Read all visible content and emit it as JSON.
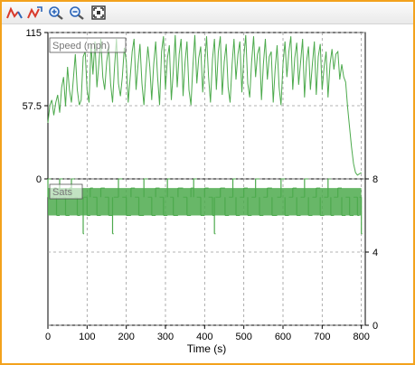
{
  "toolbar": {
    "buttons": [
      {
        "name": "autoscale-y-icon",
        "color": "#d93a2b"
      },
      {
        "name": "autoscale-x-icon",
        "color": "#d93a2b"
      },
      {
        "name": "zoom-in-icon",
        "color": "#2a64b8"
      },
      {
        "name": "zoom-out-icon",
        "color": "#2a64b8"
      },
      {
        "name": "fit-all-icon",
        "color": "#333333"
      }
    ]
  },
  "colors": {
    "frame": "#f3a21d",
    "series": "#4daa4d",
    "grid": "#9a9a9a",
    "axis": "#000000"
  },
  "chart_data": [
    {
      "type": "line",
      "series": [
        {
          "name": "Speed (mph)"
        }
      ],
      "xlabel": "Time (s)",
      "x_ticks": [
        0,
        100,
        200,
        300,
        400,
        500,
        600,
        700,
        800
      ],
      "xlim": [
        0,
        810
      ],
      "y_ticks": [
        "0",
        "57.5",
        "115"
      ],
      "ylim": [
        0,
        115
      ],
      "grid": true,
      "legend": "top-left",
      "points": [
        [
          0,
          44
        ],
        [
          5,
          58
        ],
        [
          10,
          62
        ],
        [
          15,
          50
        ],
        [
          20,
          60
        ],
        [
          25,
          66
        ],
        [
          30,
          52
        ],
        [
          35,
          72
        ],
        [
          40,
          80
        ],
        [
          45,
          57
        ],
        [
          50,
          88
        ],
        [
          55,
          70
        ],
        [
          60,
          60
        ],
        [
          65,
          79
        ],
        [
          70,
          98
        ],
        [
          75,
          70
        ],
        [
          80,
          58
        ],
        [
          85,
          62
        ],
        [
          90,
          96
        ],
        [
          95,
          100
        ],
        [
          100,
          70
        ],
        [
          105,
          60
        ],
        [
          110,
          106
        ],
        [
          115,
          82
        ],
        [
          120,
          108
        ],
        [
          125,
          72
        ],
        [
          130,
          90
        ],
        [
          135,
          110
        ],
        [
          140,
          80
        ],
        [
          145,
          70
        ],
        [
          150,
          92
        ],
        [
          155,
          104
        ],
        [
          160,
          75
        ],
        [
          165,
          60
        ],
        [
          170,
          88
        ],
        [
          175,
          110
        ],
        [
          180,
          75
        ],
        [
          185,
          65
        ],
        [
          190,
          80
        ],
        [
          195,
          103
        ],
        [
          200,
          92
        ],
        [
          205,
          60
        ],
        [
          210,
          80
        ],
        [
          215,
          100
        ],
        [
          220,
          110
        ],
        [
          225,
          70
        ],
        [
          230,
          90
        ],
        [
          235,
          106
        ],
        [
          240,
          75
        ],
        [
          245,
          58
        ],
        [
          250,
          83
        ],
        [
          255,
          104
        ],
        [
          260,
          88
        ],
        [
          265,
          62
        ],
        [
          270,
          90
        ],
        [
          275,
          108
        ],
        [
          280,
          80
        ],
        [
          285,
          58
        ],
        [
          290,
          100
        ],
        [
          295,
          112
        ],
        [
          300,
          70
        ],
        [
          305,
          95
        ],
        [
          310,
          105
        ],
        [
          315,
          62
        ],
        [
          320,
          85
        ],
        [
          325,
          113
        ],
        [
          330,
          72
        ],
        [
          335,
          98
        ],
        [
          340,
          110
        ],
        [
          345,
          65
        ],
        [
          350,
          92
        ],
        [
          355,
          108
        ],
        [
          360,
          70
        ],
        [
          365,
          58
        ],
        [
          370,
          88
        ],
        [
          375,
          113
        ],
        [
          380,
          75
        ],
        [
          385,
          95
        ],
        [
          390,
          104
        ],
        [
          395,
          68
        ],
        [
          400,
          90
        ],
        [
          405,
          112
        ],
        [
          410,
          80
        ],
        [
          415,
          60
        ],
        [
          420,
          94
        ],
        [
          425,
          110
        ],
        [
          430,
          70
        ],
        [
          435,
          100
        ],
        [
          440,
          112
        ],
        [
          445,
          66
        ],
        [
          450,
          92
        ],
        [
          455,
          106
        ],
        [
          460,
          72
        ],
        [
          465,
          60
        ],
        [
          470,
          90
        ],
        [
          475,
          110
        ],
        [
          480,
          78
        ],
        [
          485,
          98
        ],
        [
          490,
          108
        ],
        [
          495,
          68
        ],
        [
          500,
          96
        ],
        [
          505,
          113
        ],
        [
          510,
          75
        ],
        [
          515,
          64
        ],
        [
          520,
          92
        ],
        [
          525,
          112
        ],
        [
          530,
          80
        ],
        [
          535,
          98
        ],
        [
          540,
          104
        ],
        [
          545,
          62
        ],
        [
          550,
          90
        ],
        [
          555,
          110
        ],
        [
          560,
          78
        ],
        [
          565,
          96
        ],
        [
          570,
          100
        ],
        [
          575,
          60
        ],
        [
          580,
          86
        ],
        [
          585,
          105
        ],
        [
          590,
          72
        ],
        [
          595,
          58
        ],
        [
          600,
          90
        ],
        [
          605,
          108
        ],
        [
          610,
          80
        ],
        [
          615,
          100
        ],
        [
          620,
          112
        ],
        [
          625,
          70
        ],
        [
          630,
          95
        ],
        [
          635,
          107
        ],
        [
          640,
          74
        ],
        [
          645,
          92
        ],
        [
          650,
          110
        ],
        [
          655,
          64
        ],
        [
          660,
          92
        ],
        [
          665,
          104
        ],
        [
          670,
          70
        ],
        [
          675,
          90
        ],
        [
          680,
          108
        ],
        [
          685,
          66
        ],
        [
          690,
          96
        ],
        [
          695,
          106
        ],
        [
          700,
          70
        ],
        [
          705,
          88
        ],
        [
          710,
          100
        ],
        [
          715,
          64
        ],
        [
          720,
          90
        ],
        [
          725,
          102
        ],
        [
          730,
          86
        ],
        [
          735,
          98
        ],
        [
          740,
          100
        ],
        [
          745,
          78
        ],
        [
          750,
          90
        ],
        [
          755,
          80
        ],
        [
          760,
          76
        ],
        [
          765,
          56
        ],
        [
          770,
          40
        ],
        [
          775,
          25
        ],
        [
          780,
          12
        ],
        [
          785,
          5
        ],
        [
          790,
          3
        ],
        [
          795,
          4
        ],
        [
          800,
          5
        ]
      ]
    },
    {
      "type": "line",
      "series": [
        {
          "name": "Sats"
        }
      ],
      "y_ticks": [
        "0",
        "4",
        "8"
      ],
      "ylim": [
        0,
        8
      ],
      "grid": true,
      "legend": "top-left",
      "baseline": 7,
      "steps": [
        [
          0,
          8
        ],
        [
          8,
          7
        ],
        [
          15,
          7.5
        ],
        [
          22,
          6
        ],
        [
          30,
          8
        ],
        [
          38,
          7
        ],
        [
          45,
          6
        ],
        [
          55,
          7.5
        ],
        [
          60,
          8
        ],
        [
          68,
          7
        ],
        [
          75,
          6
        ],
        [
          82,
          7
        ],
        [
          90,
          5
        ],
        [
          92,
          7
        ],
        [
          100,
          6
        ],
        [
          108,
          7.5
        ],
        [
          115,
          7
        ],
        [
          125,
          6
        ],
        [
          135,
          7.5
        ],
        [
          145,
          7
        ],
        [
          155,
          6
        ],
        [
          165,
          5
        ],
        [
          168,
          7
        ],
        [
          180,
          8
        ],
        [
          190,
          7
        ],
        [
          200,
          6
        ],
        [
          212,
          7.5
        ],
        [
          222,
          7
        ],
        [
          232,
          6
        ],
        [
          245,
          8
        ],
        [
          255,
          7
        ],
        [
          265,
          6
        ],
        [
          275,
          7.5
        ],
        [
          285,
          7
        ],
        [
          295,
          6
        ],
        [
          305,
          8
        ],
        [
          312,
          7
        ],
        [
          320,
          6
        ],
        [
          332,
          7.5
        ],
        [
          345,
          7
        ],
        [
          355,
          6
        ],
        [
          365,
          7.5
        ],
        [
          372,
          8
        ],
        [
          380,
          7
        ],
        [
          390,
          6
        ],
        [
          400,
          7.5
        ],
        [
          410,
          7
        ],
        [
          420,
          6
        ],
        [
          425,
          5
        ],
        [
          428,
          7
        ],
        [
          440,
          7.5
        ],
        [
          452,
          6
        ],
        [
          462,
          7
        ],
        [
          472,
          8
        ],
        [
          480,
          6
        ],
        [
          490,
          7
        ],
        [
          500,
          7.5
        ],
        [
          510,
          6
        ],
        [
          520,
          7
        ],
        [
          530,
          8
        ],
        [
          540,
          6
        ],
        [
          550,
          7
        ],
        [
          560,
          7.5
        ],
        [
          572,
          6
        ],
        [
          585,
          7
        ],
        [
          595,
          8
        ],
        [
          605,
          6
        ],
        [
          615,
          7
        ],
        [
          625,
          7.5
        ],
        [
          635,
          6
        ],
        [
          645,
          7
        ],
        [
          655,
          8
        ],
        [
          665,
          6
        ],
        [
          675,
          7
        ],
        [
          685,
          7.5
        ],
        [
          695,
          6
        ],
        [
          705,
          7
        ],
        [
          715,
          8
        ],
        [
          722,
          6
        ],
        [
          730,
          7
        ],
        [
          740,
          7.5
        ],
        [
          750,
          6
        ],
        [
          760,
          7
        ],
        [
          770,
          6
        ],
        [
          780,
          7
        ],
        [
          790,
          6
        ],
        [
          795,
          7
        ],
        [
          800,
          5
        ]
      ]
    }
  ]
}
